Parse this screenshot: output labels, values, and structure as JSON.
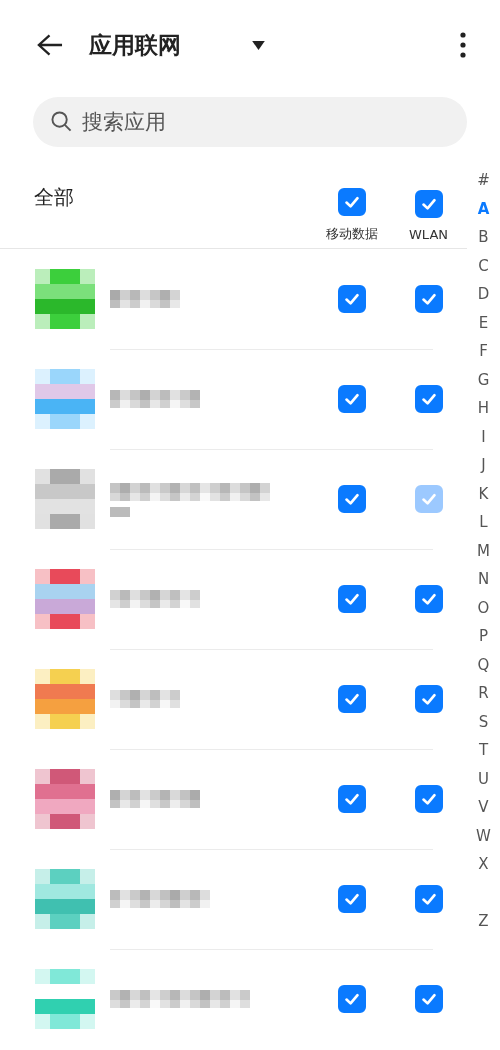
{
  "app_bar": {
    "title": "应用联网"
  },
  "search": {
    "placeholder": "搜索应用"
  },
  "header": {
    "label": "全部",
    "columns": [
      {
        "label": "移动数据",
        "checked": true
      },
      {
        "label": "WLAN",
        "checked": true
      }
    ]
  },
  "apps": [
    {
      "kind": "picture",
      "mobile_data": {
        "checked": true,
        "disabled": false
      },
      "wlan": {
        "checked": true,
        "disabled": false
      }
    },
    {
      "kind": "picture",
      "mobile_data": {
        "checked": true,
        "disabled": false
      },
      "wlan": {
        "checked": true,
        "disabled": false
      }
    },
    {
      "kind": "picture",
      "mobile_data": {
        "checked": true,
        "disabled": false
      },
      "wlan": {
        "checked": true,
        "disabled": true
      }
    },
    {
      "kind": "picture",
      "mobile_data": {
        "checked": true,
        "disabled": false
      },
      "wlan": {
        "checked": true,
        "disabled": false
      }
    },
    {
      "kind": "picture",
      "mobile_data": {
        "checked": true,
        "disabled": false
      },
      "wlan": {
        "checked": true,
        "disabled": false
      }
    },
    {
      "kind": "picture",
      "mobile_data": {
        "checked": true,
        "disabled": false
      },
      "wlan": {
        "checked": true,
        "disabled": false
      }
    },
    {
      "kind": "picture",
      "mobile_data": {
        "checked": true,
        "disabled": false
      },
      "wlan": {
        "checked": true,
        "disabled": false
      }
    },
    {
      "kind": "picture",
      "mobile_data": {
        "checked": true,
        "disabled": false
      },
      "wlan": {
        "checked": true,
        "disabled": false
      }
    }
  ],
  "index": [
    {
      "label": "#",
      "selected": false
    },
    {
      "label": "A",
      "selected": true
    },
    {
      "label": "B",
      "selected": false
    },
    {
      "label": "C",
      "selected": false
    },
    {
      "label": "D",
      "selected": false
    },
    {
      "label": "E",
      "selected": false
    },
    {
      "label": "F",
      "selected": false
    },
    {
      "label": "G",
      "selected": false
    },
    {
      "label": "H",
      "selected": false
    },
    {
      "label": "I",
      "selected": false
    },
    {
      "label": "J",
      "selected": false
    },
    {
      "label": "K",
      "selected": false
    },
    {
      "label": "L",
      "selected": false
    },
    {
      "label": "M",
      "selected": false
    },
    {
      "label": "N",
      "selected": false
    },
    {
      "label": "O",
      "selected": false
    },
    {
      "label": "P",
      "selected": false
    },
    {
      "label": "Q",
      "selected": false
    },
    {
      "label": "R",
      "selected": false
    },
    {
      "label": "S",
      "selected": false
    },
    {
      "label": "T",
      "selected": false
    },
    {
      "label": "U",
      "selected": false
    },
    {
      "label": "V",
      "selected": false
    },
    {
      "label": "W",
      "selected": false
    },
    {
      "label": "X",
      "selected": false
    },
    {
      "label": "Z",
      "selected": false
    }
  ]
}
